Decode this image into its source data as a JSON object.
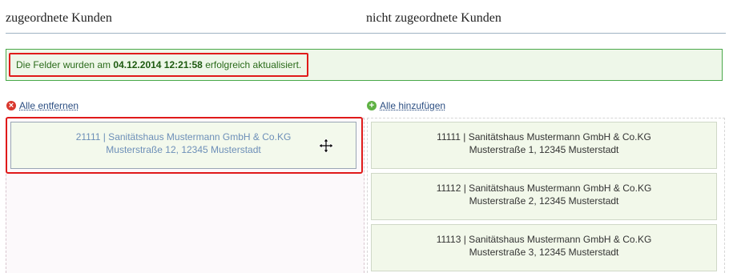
{
  "headings": {
    "assigned": "zugeordnete Kunden",
    "unassigned": "nicht zugeordnete Kunden"
  },
  "alert": {
    "prefix": "Die Felder wurden am",
    "timestamp": "04.12.2014 12:21:58",
    "suffix": "erfolgreich aktualisiert."
  },
  "actions": {
    "remove_all": "Alle entfernen",
    "add_all": "Alle hinzufügen"
  },
  "assigned_customers": [
    {
      "line1": "21111 | Sanitätshaus Mustermann GmbH & Co.KG",
      "line2": "Musterstraße 12, 12345 Musterstadt"
    }
  ],
  "unassigned_customers": [
    {
      "line1": "11111 | Sanitätshaus Mustermann GmbH & Co.KG",
      "line2": "Musterstraße 1, 12345 Musterstadt"
    },
    {
      "line1": "11112 | Sanitätshaus Mustermann GmbH & Co.KG",
      "line2": "Musterstraße 2, 12345 Musterstadt"
    },
    {
      "line1": "11113 | Sanitätshaus Mustermann GmbH & Co.KG",
      "line2": "Musterstraße 3, 12345 Musterstadt"
    }
  ],
  "icons": {
    "remove": "remove-circle-icon",
    "add": "add-circle-icon",
    "cursor": "move-cursor-icon"
  },
  "colors": {
    "alert_border": "#4aa84a",
    "highlight": "#e01a1a",
    "card_bg": "#f2f8ea",
    "link": "#2b4e82"
  }
}
